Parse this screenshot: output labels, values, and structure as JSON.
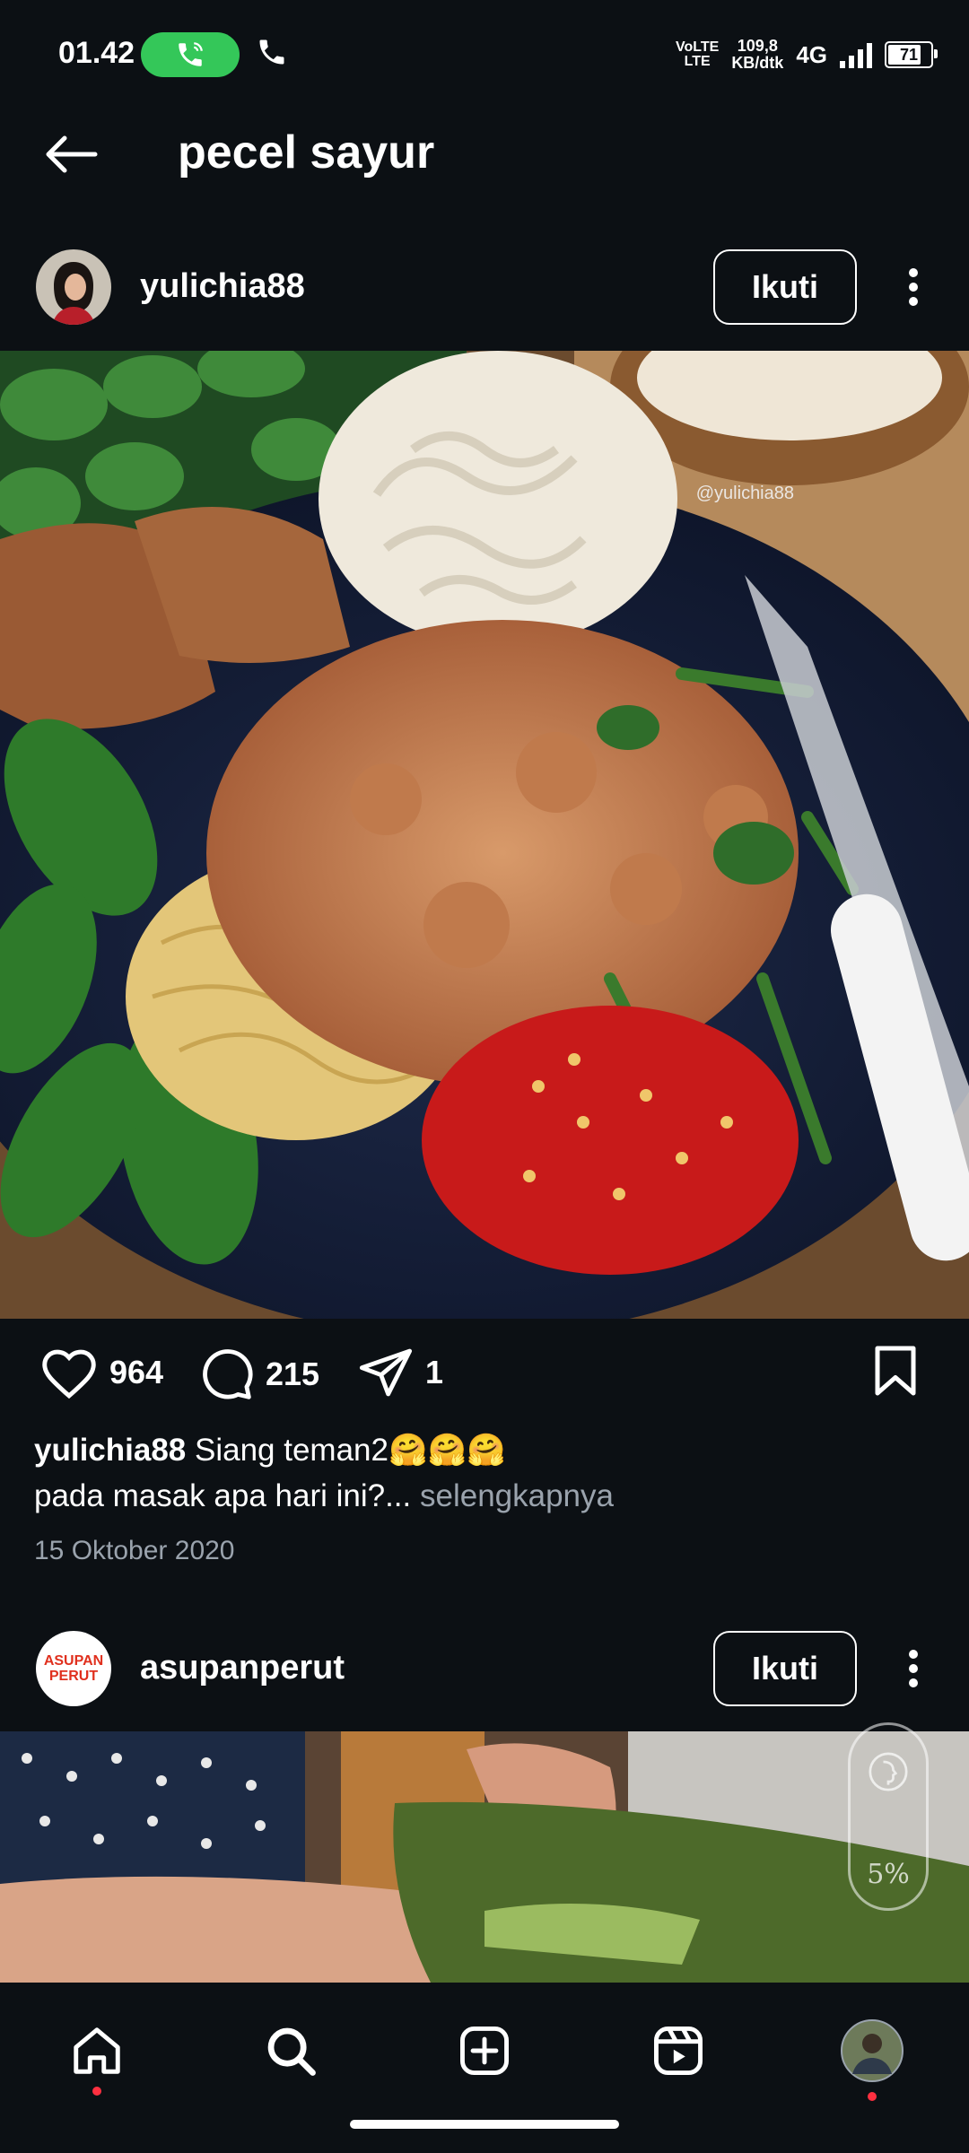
{
  "status_bar": {
    "time": "01.42",
    "network_top": "VoLTE",
    "network_bottom": "LTE",
    "speed_value": "109,8",
    "speed_unit": "KB/dtk",
    "network_type": "4G",
    "battery_level": "71"
  },
  "header": {
    "title": "pecel sayur",
    "back_icon": "arrow-left-icon"
  },
  "post1": {
    "username": "yulichia88",
    "follow_label": "Ikuti",
    "image_watermark": "@yulichia88",
    "likes": "964",
    "comments": "215",
    "shares": "1",
    "caption_user": "yulichia88",
    "caption_text": " Siang teman2🤗🤗🤗",
    "caption_line2": "pada masak apa hari ini?...",
    "more_label": " selengkapnya",
    "date": "15 Oktober 2020"
  },
  "post2": {
    "username": "asupanperut",
    "avatar_text_top": "ASUPAN",
    "avatar_text_bottom": "PERUT",
    "follow_label": "Ikuti",
    "progress_badge": "5%"
  },
  "bottom_nav": {
    "items": [
      "home-icon",
      "search-icon",
      "create-icon",
      "reels-icon",
      "profile-avatar"
    ]
  },
  "colors": {
    "background": "#0c1014",
    "accent_green": "#34c759",
    "notification_red": "#ff3040",
    "muted_text": "#9aa3ad"
  }
}
